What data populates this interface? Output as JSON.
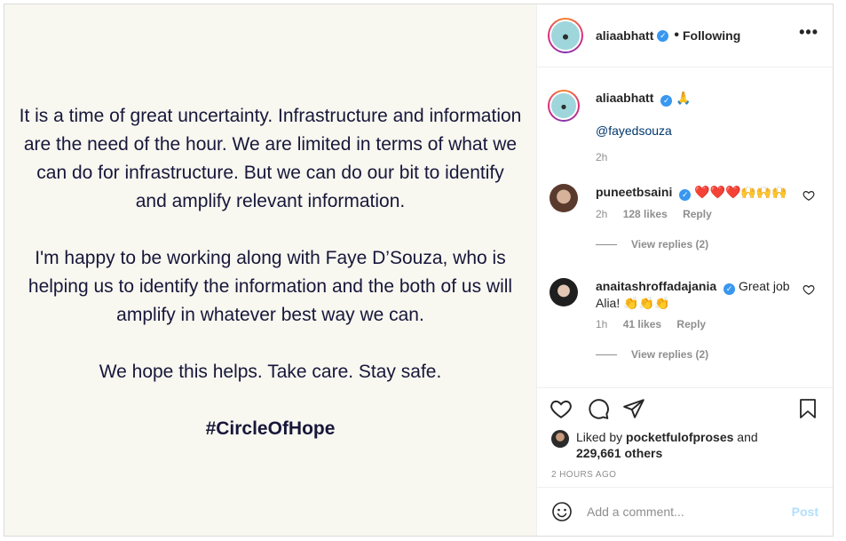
{
  "post_image": {
    "paragraphs": [
      "It is a time of great uncertainty. Infrastructure and information are the need of the hour. We are limited in terms of what we can do for infrastructure. But we can do our bit to identify and amplify relevant information.",
      "I'm happy to be working along with Faye D’Souza, who is helping us to identify the information and the both of us will amplify in whatever best way we can.",
      "We hope this helps. Take care. Stay safe."
    ],
    "hashtag": "#CircleOfHope"
  },
  "header": {
    "username": "aliaabhatt",
    "separator": "•",
    "follow_status": "Following",
    "more_icon": "more-horizontal-icon"
  },
  "caption": {
    "username": "aliaabhatt",
    "emoji": "🙏",
    "mention": "@fayedsouza",
    "time": "2h"
  },
  "comments": [
    {
      "username": "puneetbsaini",
      "text": "❤️❤️❤️🙌🙌🙌",
      "time": "2h",
      "likes": "128 likes",
      "reply": "Reply",
      "view_replies": "View replies (2)",
      "avatar_color": "#7a5a4a"
    },
    {
      "username": "anaitashroffadajania",
      "text": "Great job Alia! 👏👏👏",
      "time": "1h",
      "likes": "41 likes",
      "reply": "Reply",
      "view_replies": "View replies (2)",
      "avatar_color": "#3a3a3a"
    }
  ],
  "actions": {
    "like_icon": "heart-icon",
    "comment_icon": "comment-icon",
    "share_icon": "send-icon",
    "save_icon": "bookmark-icon"
  },
  "likes": {
    "prefix": "Liked by",
    "user": "pocketfulofproses",
    "and": "and",
    "count": "229,661 others"
  },
  "timestamp": "2 HOURS AGO",
  "add_comment": {
    "placeholder": "Add a comment...",
    "post_label": "Post",
    "emoji_icon": "smiley-icon"
  },
  "colors": {
    "verified": "#3897f0",
    "post_button_disabled": "#b2dffc",
    "image_background": "#f8f7f0",
    "image_text": "#17173a"
  }
}
